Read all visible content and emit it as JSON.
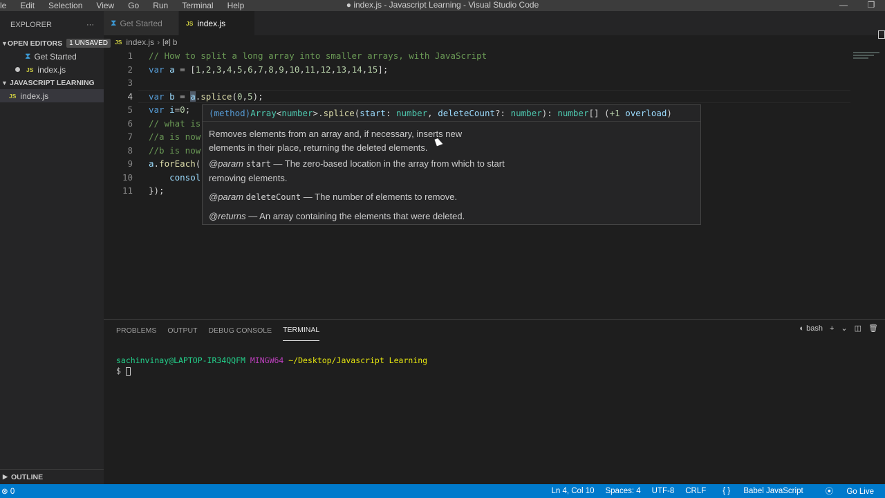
{
  "titlebar": {
    "menus": [
      "le",
      "Edit",
      "Selection",
      "View",
      "Go",
      "Run",
      "Terminal",
      "Help"
    ],
    "title": "● index.js - Javascript Learning - Visual Studio Code",
    "minimize": "—",
    "restore": "❐"
  },
  "sidebar": {
    "title": "EXPLORER",
    "more": "···",
    "open_editors": {
      "label": "OPEN EDITORS",
      "badge": "1 UNSAVED"
    },
    "open_items": [
      {
        "label": "Get Started",
        "icon": "vscode-icon"
      },
      {
        "label": "index.js",
        "icon": "js-icon",
        "dirty": true
      }
    ],
    "project": {
      "label": "JAVASCRIPT LEARNING"
    },
    "files": [
      {
        "label": "index.js",
        "icon": "js-icon"
      }
    ],
    "outline": "OUTLINE",
    "js_badge": "JS"
  },
  "tabs": [
    {
      "label": "Get Started",
      "active": false
    },
    {
      "label": "index.js",
      "active": true,
      "dirty": true
    }
  ],
  "breadcrumb": {
    "file": "index.js",
    "symbol": "b"
  },
  "editor": {
    "current_line": 4,
    "lines": [
      "// How to split a long array into smaller arrays, with JavaScript",
      "var a = [1,2,3,4,5,6,7,8,9,10,11,12,13,14,15];",
      "",
      "var b = a.splice(0,5);",
      "var i=0;",
      "// what is",
      "//a is now",
      "//b is now",
      "a.forEach(",
      "    consol",
      "});"
    ],
    "line_numbers": [
      "1",
      "2",
      "3",
      "4",
      "5",
      "6",
      "7",
      "8",
      "9",
      "10",
      "11"
    ]
  },
  "hover": {
    "signature": "(method) Array<number>.splice(start: number, deleteCount?: number): number[] (+1 overload)",
    "description": "Removes elements from an array and, if necessary, inserts new elements in their place, returning the deleted elements.",
    "param1_tag": "@param",
    "param1_name": "start",
    "param1_desc": " — The zero-based location in the array from which to start removing elements.",
    "param2_tag": "@param",
    "param2_name": "deleteCount",
    "param2_desc": " — The number of elements to remove.",
    "returns_tag": "@returns",
    "returns_desc": " — An array containing the elements that were deleted."
  },
  "panel": {
    "tabs": [
      "PROBLEMS",
      "OUTPUT",
      "DEBUG CONSOLE",
      "TERMINAL"
    ],
    "active_tab": "TERMINAL",
    "shell": "bash",
    "terminal": {
      "user": "sachinvinay@LAPTOP-IR34QQFM",
      "env": "MINGW64",
      "path": "~/Desktop/Javascript Learning",
      "prompt": "$"
    }
  },
  "status": {
    "left": "⊗ 0",
    "position": "Ln 4, Col 10",
    "spaces": "Spaces: 4",
    "encoding": "UTF-8",
    "eol": "CRLF",
    "language": "Babel JavaScript",
    "golive": "Go Live",
    "braces": "{ }"
  }
}
